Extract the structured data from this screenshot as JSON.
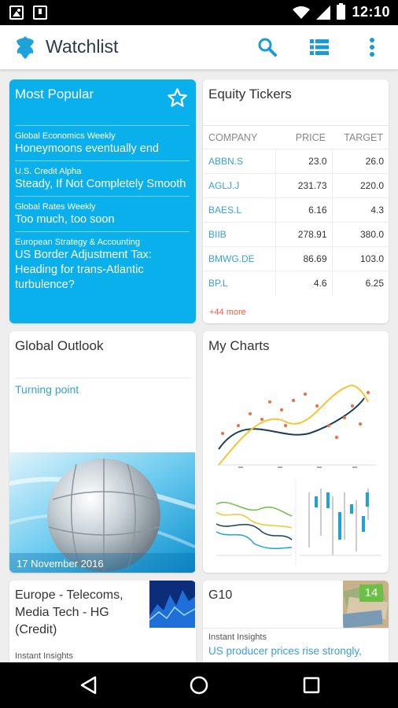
{
  "status": {
    "time": "12:10"
  },
  "app": {
    "title": "Watchlist"
  },
  "most_popular": {
    "title": "Most Popular",
    "items": [
      {
        "category": "Global Economics Weekly",
        "headline": "Honeymoons eventually end"
      },
      {
        "category": "U.S. Credit Alpha",
        "headline": "Steady, If Not Completely Smooth"
      },
      {
        "category": "Global Rates Weekly",
        "headline": "Too much, too soon"
      },
      {
        "category": "European Strategy & Accounting",
        "headline": "US Border Adjustment Tax: Heading for trans-Atlantic turbulence?"
      }
    ]
  },
  "equity": {
    "title": "Equity Tickers",
    "columns": [
      "COMPANY",
      "PRICE",
      "TARGET"
    ],
    "rows": [
      {
        "company": "ABBN.S",
        "price": "23.0",
        "target": "26.0"
      },
      {
        "company": "AGLJ.J",
        "price": "231.73",
        "target": "220.0"
      },
      {
        "company": "BAES.L",
        "price": "6.16",
        "target": "4.3"
      },
      {
        "company": "BIIB",
        "price": "278.91",
        "target": "380.0"
      },
      {
        "company": "BMWG.DE",
        "price": "86.69",
        "target": "103.0"
      },
      {
        "company": "BP.L",
        "price": "4.6",
        "target": "6.25"
      }
    ],
    "more": "+44 more"
  },
  "global_outlook": {
    "title": "Global Outlook",
    "link": "Turning point",
    "date": "17 November 2016"
  },
  "my_charts": {
    "title": "My Charts"
  },
  "europe": {
    "title": "Europe - Telecoms, Media Tech - HG (Credit)",
    "tag": "Instant Insights"
  },
  "g10": {
    "title": "G10",
    "badge": "14",
    "tag": "Instant Insights",
    "headline": "US producer prices rise strongly,"
  },
  "colors": {
    "accent": "#0ab0ec",
    "link": "#3aa0d8",
    "badge": "#6cbf45",
    "more": "#f06040"
  }
}
